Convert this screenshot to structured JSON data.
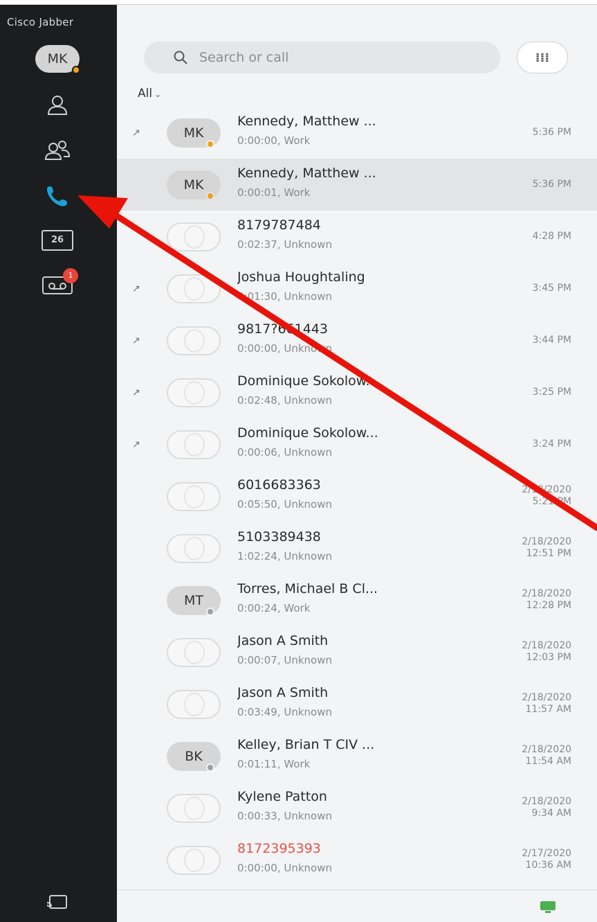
{
  "app": {
    "title": "Cisco Jabber"
  },
  "self": {
    "initials": "MK",
    "presence_color": "#f0a21a"
  },
  "nav": {
    "contacts": {
      "icon": "contact-icon"
    },
    "people": {
      "icon": "people-icon"
    },
    "calls": {
      "icon": "phone-icon",
      "color": "#18a3d9"
    },
    "calendar": {
      "icon": "calendar-icon",
      "label": "26"
    },
    "voicemail": {
      "icon": "voicemail-icon",
      "badge": "1"
    },
    "share": {
      "icon": "screen-share-icon"
    }
  },
  "search": {
    "placeholder": "Search or call"
  },
  "dialpad": {
    "label": "⁞⁞⁞",
    "icon": "dialpad-icon"
  },
  "filter": {
    "label": "All"
  },
  "calls": [
    {
      "name": "Kennedy, Matthew ...",
      "detail": "0:00:00, Work",
      "time1": "5:36 PM",
      "time2": "",
      "outgoing": true,
      "avatar": "MK",
      "presence": "#f0a21a",
      "selected": false,
      "missed": false
    },
    {
      "name": "Kennedy, Matthew ...",
      "detail": "0:00:01, Work",
      "time1": "5:36 PM",
      "time2": "",
      "outgoing": false,
      "avatar": "MK",
      "presence": "#f0a21a",
      "selected": true,
      "missed": false
    },
    {
      "name": "8179787484",
      "detail": "0:02:37, Unknown",
      "time1": "4:28 PM",
      "time2": "",
      "outgoing": false,
      "avatar": "",
      "presence": "",
      "selected": false,
      "missed": false
    },
    {
      "name": "Joshua Houghtaling",
      "detail": "0:01:30, Unknown",
      "time1": "3:45 PM",
      "time2": "",
      "outgoing": true,
      "avatar": "",
      "presence": "",
      "selected": false,
      "missed": false
    },
    {
      "name": "9817?661443",
      "detail": "0:00:00, Unknown",
      "time1": "3:44 PM",
      "time2": "",
      "outgoing": true,
      "avatar": "",
      "presence": "",
      "selected": false,
      "missed": false
    },
    {
      "name": "Dominique Sokolow...",
      "detail": "0:02:48, Unknown",
      "time1": "3:25 PM",
      "time2": "",
      "outgoing": true,
      "avatar": "",
      "presence": "",
      "selected": false,
      "missed": false
    },
    {
      "name": "Dominique Sokolow...",
      "detail": "0:00:06, Unknown",
      "time1": "3:24 PM",
      "time2": "",
      "outgoing": true,
      "avatar": "",
      "presence": "",
      "selected": false,
      "missed": false
    },
    {
      "name": "6016683363",
      "detail": "0:05:50, Unknown",
      "time1": "2/18/2020",
      "time2": "5:21 PM",
      "outgoing": false,
      "avatar": "",
      "presence": "",
      "selected": false,
      "missed": false
    },
    {
      "name": "5103389438",
      "detail": "1:02:24, Unknown",
      "time1": "2/18/2020",
      "time2": "12:51 PM",
      "outgoing": false,
      "avatar": "",
      "presence": "",
      "selected": false,
      "missed": false
    },
    {
      "name": "Torres, Michael B Cl...",
      "detail": "0:00:24, Work",
      "time1": "2/18/2020",
      "time2": "12:28 PM",
      "outgoing": false,
      "avatar": "MT",
      "presence": "#a0a0a0",
      "selected": false,
      "missed": false
    },
    {
      "name": "Jason A Smith",
      "detail": "0:00:07, Unknown",
      "time1": "2/18/2020",
      "time2": "12:03 PM",
      "outgoing": false,
      "avatar": "",
      "presence": "",
      "selected": false,
      "missed": false
    },
    {
      "name": "Jason A Smith",
      "detail": "0:03:49, Unknown",
      "time1": "2/18/2020",
      "time2": "11:57 AM",
      "outgoing": false,
      "avatar": "",
      "presence": "",
      "selected": false,
      "missed": false
    },
    {
      "name": "Kelley, Brian T CIV ...",
      "detail": "0:01:11, Work",
      "time1": "2/18/2020",
      "time2": "11:54 AM",
      "outgoing": false,
      "avatar": "BK",
      "presence": "#a0a0a0",
      "selected": false,
      "missed": false
    },
    {
      "name": "Kylene Patton",
      "detail": "0:00:33, Unknown",
      "time1": "2/18/2020",
      "time2": "9:34 AM",
      "outgoing": false,
      "avatar": "",
      "presence": "",
      "selected": false,
      "missed": false
    },
    {
      "name": "8172395393",
      "detail": "0:00:00, Unknown",
      "time1": "2/17/2020",
      "time2": "10:36 AM",
      "outgoing": false,
      "avatar": "",
      "presence": "",
      "selected": false,
      "missed": true
    }
  ],
  "footer": {
    "icon": "monitor-icon",
    "color": "#4caf50"
  },
  "annotation": {
    "color": "#e8140a"
  }
}
